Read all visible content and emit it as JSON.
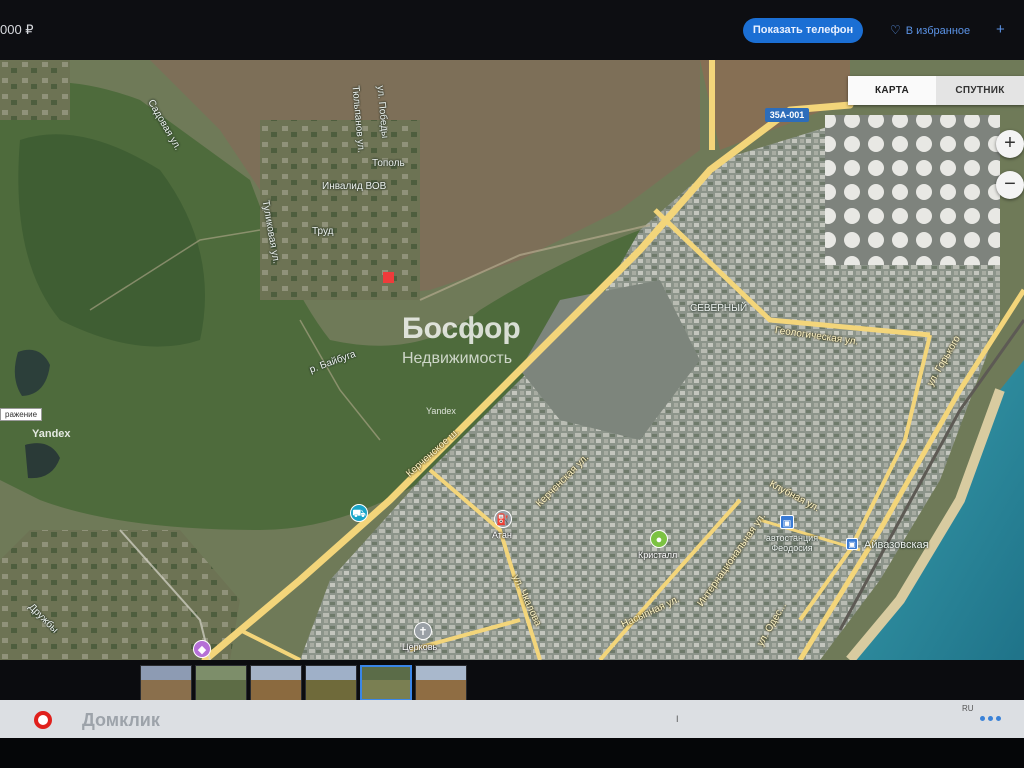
{
  "header": {
    "price_fragment": "000 ₽",
    "show_phone_label": "Показать телефон",
    "favorites_label": "В избранное",
    "add_icon": "plus-icon",
    "favorites_icon": "heart-icon"
  },
  "map": {
    "map_type_tabs": [
      {
        "label": "КАРТА",
        "active": true
      },
      {
        "label": "СПУТНИК",
        "active": false
      }
    ],
    "zoom_in": "+",
    "zoom_out": "−",
    "watermark_title": "Босфор",
    "watermark_subtitle": "Недвижимость",
    "terrain_tooltip": "ражение",
    "yandex_logo": "Yandex",
    "yandex_small": "Yandex",
    "road_shield": "35А-001",
    "place_labels": {
      "sadovaya": "Садовая ул.",
      "tulpanovaya": "Тюльпанов ул.",
      "pobedy": "ул. Победы",
      "topol": "Тополь",
      "invalid": "Инвалид ВОВ",
      "tulikovaya": "Туликовая ул.",
      "trud": "Труд",
      "baybuga": "р. Байбуга",
      "severny": "СЕВЕРНЫЙ",
      "geologicheskaya": "Геологическая ул.",
      "kerchenskoe": "Керченское ш.",
      "kerchenskaya": "Керченская ул.",
      "chkalova": "ул. Чкалова",
      "klubnaya": "Клубная ул.",
      "nasypnaya": "Насыпная ул.",
      "internatsionalnaya": "Интернациональная ул.",
      "gorkogo": "ул. Горького",
      "ordzhonikidze": "ул. Одес...",
      "aivazovskaya": "Айвазовская",
      "avtostantsiya": "автостанция Феодосия",
      "kristall": "Кристалл",
      "atan": "Атан",
      "tserkov": "Церковь",
      "druzhby": "Дружбы"
    }
  },
  "thumbnails": [
    {
      "sky": "#8d9bb3",
      "ground": "#8a6f4c",
      "active": false
    },
    {
      "sky": "#7d8e6a",
      "ground": "#5d6c45",
      "active": false
    },
    {
      "sky": "#a4b2c6",
      "ground": "#8b6a3f",
      "active": false
    },
    {
      "sky": "#9fb0c8",
      "ground": "#6f6a3a",
      "active": false
    },
    {
      "sky": "#5b6c48",
      "ground": "#7a7f52",
      "active": true
    },
    {
      "sky": "#a9b8cc",
      "ground": "#8f6d43",
      "active": false
    }
  ],
  "taskbar": {
    "app_name": "Домклик",
    "mark": "I",
    "lang": "RU"
  },
  "colors": {
    "accent_blue": "#1b6fd4",
    "link_blue": "#5b93e6",
    "road_yellow": "#f3d57a",
    "sea": "#2d8fa2",
    "marker_red": "#ef3b3b"
  }
}
